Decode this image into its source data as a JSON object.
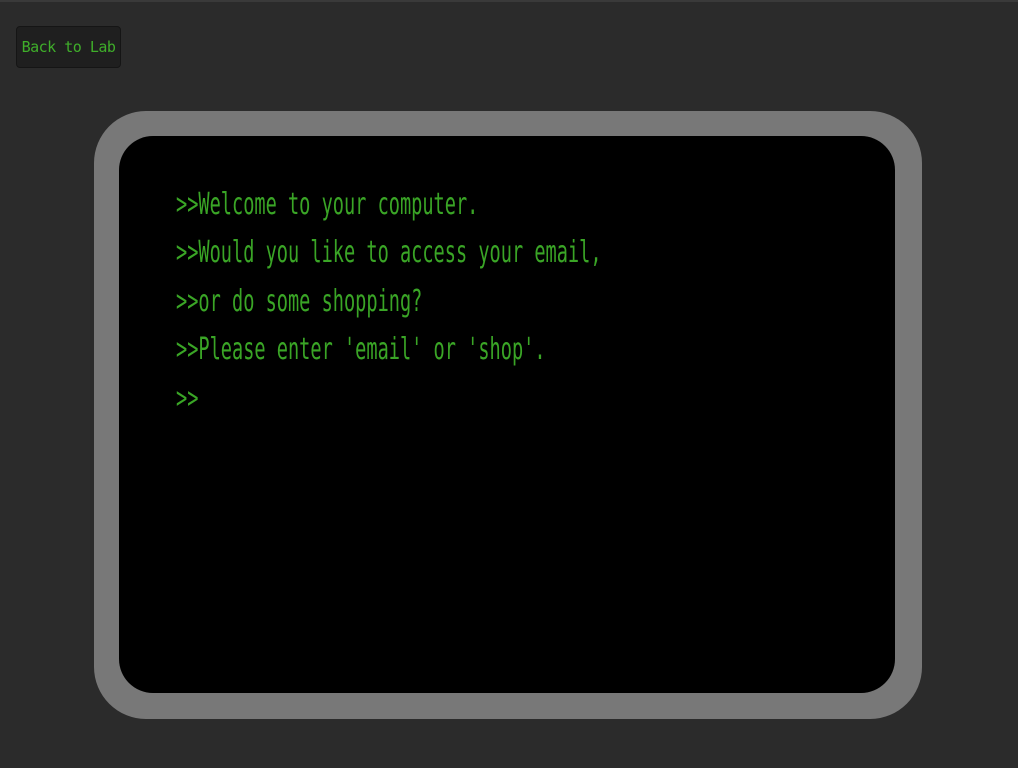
{
  "nav": {
    "back_label": "Back to Lab"
  },
  "terminal": {
    "prompt": ">>",
    "lines": [
      "Welcome to your computer.",
      "Would you like to access your email,",
      "or do some shopping?",
      "Please enter 'email' or 'shop'."
    ],
    "input_value": ""
  },
  "colors": {
    "background": "#2b2b2b",
    "bezel": "#787878",
    "screen": "#000000",
    "terminal_text": "#3aa526"
  }
}
